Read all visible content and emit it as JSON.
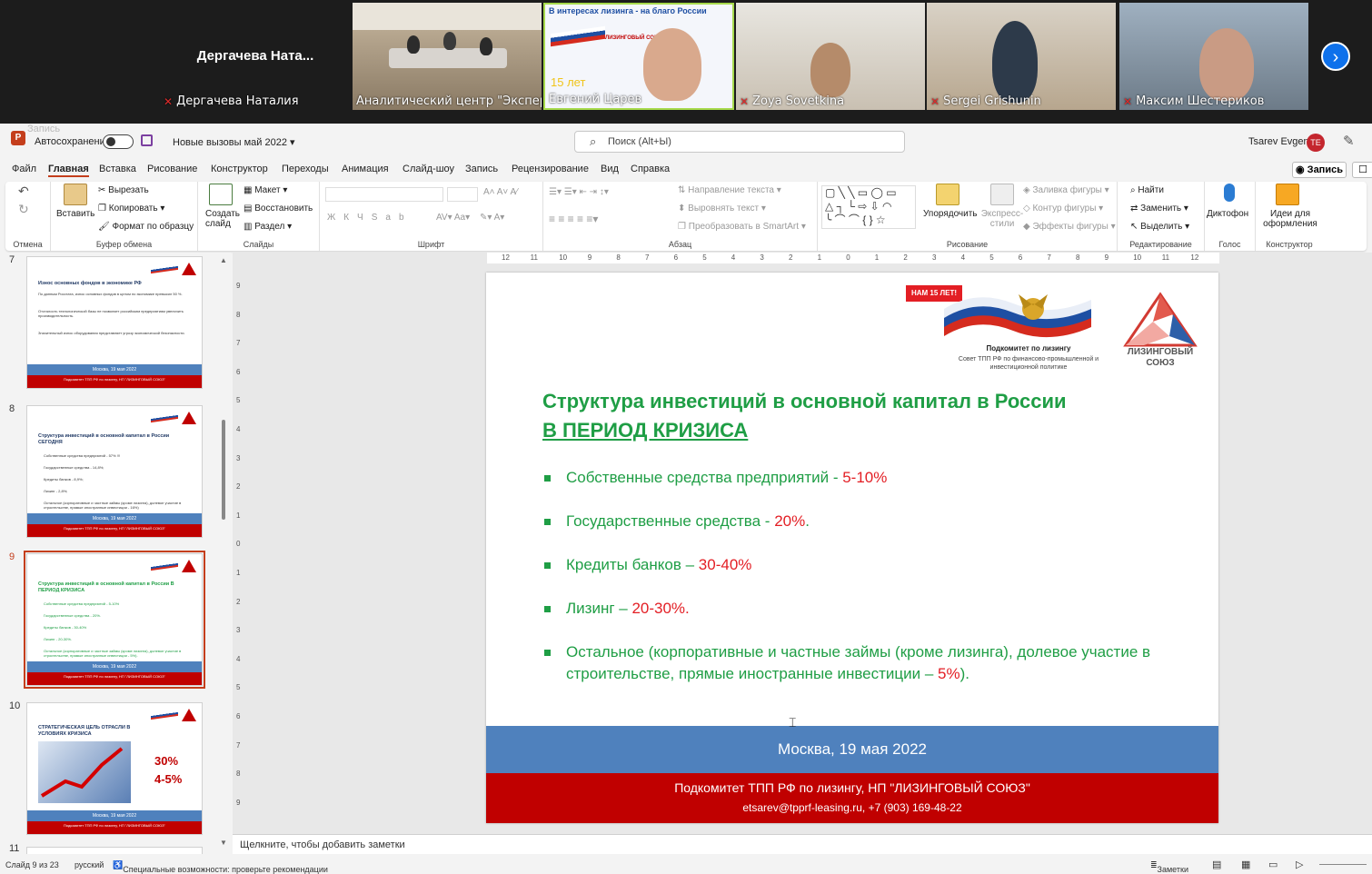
{
  "conference": {
    "tiles": [
      {
        "display_name": "Дергачева  Ната...",
        "label": "Дергачева Наталия",
        "muted": true
      },
      {
        "label": "Аналитический центр \"Эксперт\"",
        "muted": false
      },
      {
        "label": "Евгений Царев",
        "muted": false,
        "overlay_line1": "В интересах лизинга - на благо России",
        "overlay_years": "15 лет",
        "overlay_logo": "ЛИЗИНГОВЫЙ СОЮЗ"
      },
      {
        "label": "Zoya Sovetkina",
        "muted": true
      },
      {
        "label": "Sergei Grishunin",
        "muted": true
      },
      {
        "label": "Максим Шестериков",
        "muted": true
      }
    ],
    "next_icon": "chevron-right-icon"
  },
  "window": {
    "recording_label": "Запись",
    "app_letter": "P",
    "autosave_label": "Автосохранение",
    "doc_title": "Новые вызовы май 2022",
    "search_placeholder": "Поиск (Alt+Ы)",
    "user_name": "Tsarev Evgeny",
    "user_initials": "TE"
  },
  "tabs": [
    "Файл",
    "Главная",
    "Вставка",
    "Рисование",
    "Конструктор",
    "Переходы",
    "Анимация",
    "Слайд-шоу",
    "Запись",
    "Рецензирование",
    "Вид",
    "Справка"
  ],
  "active_tab": "Главная",
  "record_button": "Запись",
  "ribbon": {
    "undo": {
      "label": "Отмена"
    },
    "clipboard": {
      "label": "Буфер обмена",
      "paste": "Вставить",
      "cut": "Вырезать",
      "copy": "Копировать",
      "format_painter": "Формат по образцу"
    },
    "slides": {
      "label": "Слайды",
      "new_slide": "Создать слайд",
      "layout": "Макет",
      "reset": "Восстановить",
      "section": "Раздел"
    },
    "font": {
      "label": "Шрифт"
    },
    "paragraph": {
      "label": "Абзац",
      "text_direction": "Направление текста",
      "align_text": "Выровнять текст",
      "smartart": "Преобразовать в SmartArt"
    },
    "drawing": {
      "label": "Рисование",
      "arrange": "Упорядочить",
      "quick_styles": "Экспресс-стили",
      "shape_fill": "Заливка фигуры",
      "shape_outline": "Контур фигуры",
      "shape_effects": "Эффекты фигуры"
    },
    "editing": {
      "label": "Редактирование",
      "find": "Найти",
      "replace": "Заменить",
      "select": "Выделить"
    },
    "voice": {
      "label": "Голос",
      "dictate": "Диктофон"
    },
    "designer": {
      "label": "Конструктор",
      "design_ideas": "Идеи для оформления"
    }
  },
  "thumbnails": [
    {
      "number": "7",
      "title": "Износ основных фондов в экономике РФ",
      "lines": [
        "По данным Росстата, износ основных фондов в целом по экономике превысил 50 %.",
        "Отсталость технологической базы не позволяет российским предприятиям увеличить производительность.",
        "Значительный износ оборудования представляет угрозу экономической безопасности."
      ],
      "footer_date": "Москва, 19 мая 2022"
    },
    {
      "number": "8",
      "title": "Структура инвестиций в основной капитал в России СЕГОДНЯ",
      "lines": [
        "Собственные средства предприятий - 57% !!!",
        "Государственные средства - 14,8%;",
        "Кредиты банков - 8,9%;",
        "Лизинг - 2,8%;",
        "Остальное (корпоративные и частные займы (кроме лизинга), долевое участие в строительстве, прямые иностранные инвестиции - 16%)"
      ],
      "footer_date": "Москва, 19 мая 2022"
    },
    {
      "number": "9",
      "title": "Структура инвестиций в основной капитал в России В ПЕРИОД КРИЗИСА",
      "lines": [
        "Собственные средства предприятий - 5-10%",
        "Государственные средства - 20%.",
        "Кредиты банков - 30-40%",
        "Лизинг - 20-30%.",
        "Остальное (корпоративные и частные займы (кроме лизинга), долевое участие в строительстве, прямые иностранные инвестиции - 5%)."
      ],
      "footer_date": "Москва, 19 мая 2022",
      "selected": true
    },
    {
      "number": "10",
      "title": "СТРАТЕГИЧЕСКАЯ ЦЕЛЬ ОТРАСЛИ В УСЛОВИЯХ КРИЗИСА",
      "lines": [],
      "big1": "30%",
      "big2": "4-5%",
      "footer_date": "Москва, 19 мая 2022"
    },
    {
      "number": "11"
    }
  ],
  "thumb_footer": "Подкомитет ТПП РФ по лизингу, НП \"ЛИЗИНГОВЫЙ СОЮЗ\"",
  "slide": {
    "badge": "НАМ 15 ЛЕТ!",
    "subcommittee_name": "Подкомитет по лизингу",
    "subcommittee_desc": "Совет ТПП РФ по финансово-промышленной и инвестиционной политике",
    "union_name": "ЛИЗИНГОВЫЙ СОЮЗ",
    "title_line1": "Структура инвестиций в основной капитал в России",
    "title_line2": "В ПЕРИОД КРИЗИСА",
    "bullets": [
      {
        "text": "Собственные средства предприятий  - ",
        "value": "5-10%",
        "tail": ""
      },
      {
        "text": "Государственные средства - ",
        "value": "20%",
        "tail": "."
      },
      {
        "text": "Кредиты банков – ",
        "value": "30-40%",
        "tail": ""
      },
      {
        "text": "Лизинг – ",
        "value": "20-30%.",
        "tail": ""
      },
      {
        "text": "Остальное (корпоративные и частные займы (кроме лизинга), долевое участие в строительстве, прямые иностранные инвестиции – ",
        "value": "5%",
        "tail": ")."
      }
    ],
    "footer_city_date": "Москва, 19 мая 2022",
    "footer_org": "Подкомитет ТПП РФ по лизингу, НП \"ЛИЗИНГОВЫЙ СОЮЗ\"",
    "footer_contacts": "etsarev@tpprf-leasing.ru, +7 (903) 169-48-22"
  },
  "notes_placeholder": "Щелкните, чтобы добавить заметки",
  "status": {
    "slide_counter": "Слайд 9 из 23",
    "language": "русский",
    "accessibility": "Специальные возможности: проверьте рекомендации",
    "notes_button": "Заметки"
  },
  "colors": {
    "accent": "#c43e1c",
    "slide_green": "#1f9e45",
    "slide_red": "#e31e24",
    "footer_blue": "#4f81bd",
    "footer_red": "#c00000"
  }
}
